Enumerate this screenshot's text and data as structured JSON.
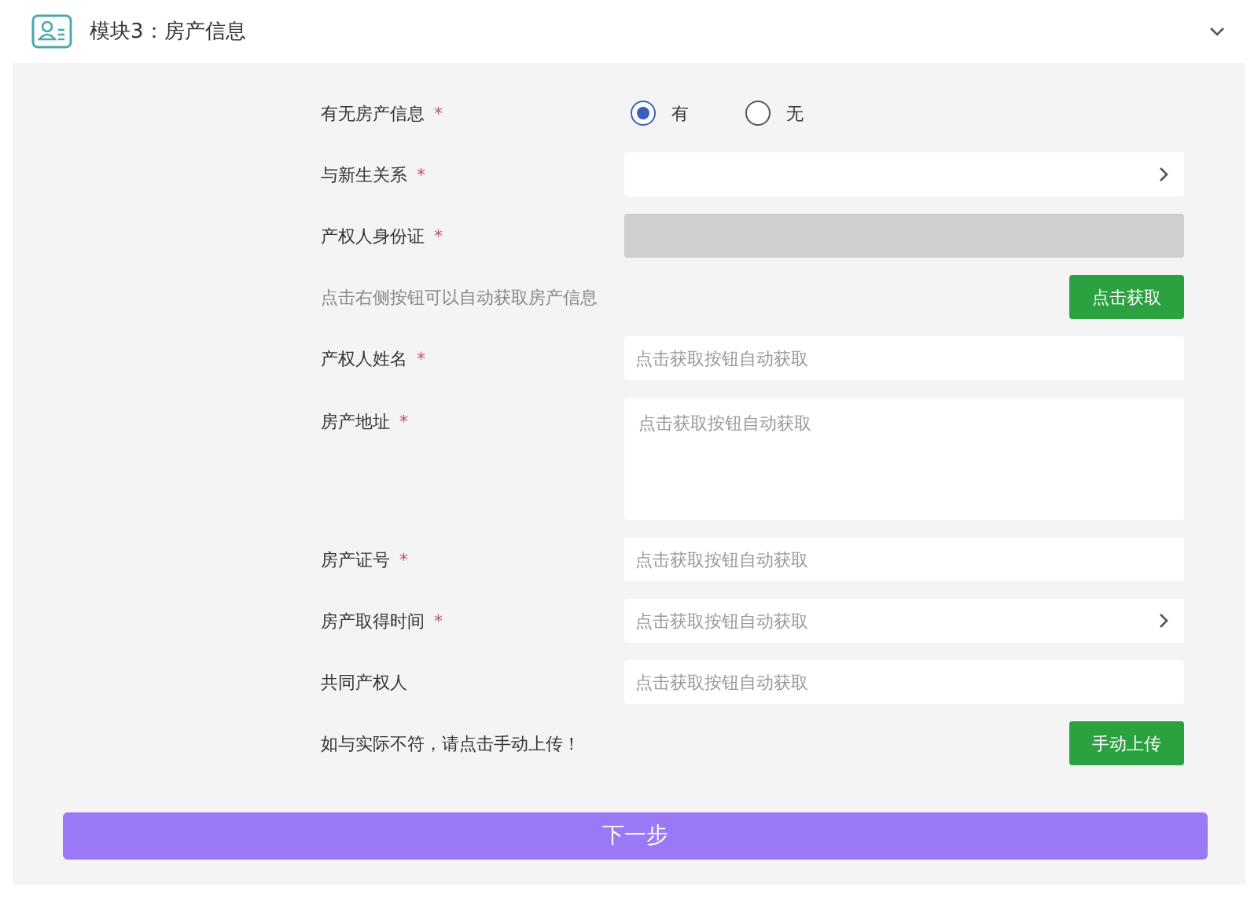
{
  "section": {
    "title": "模块3：房产信息",
    "expanded": true
  },
  "rows": [
    {
      "kind": "radio",
      "label": "有无房产信息",
      "mark": "*",
      "options": [
        {
          "label": "有",
          "selected": true
        },
        {
          "label": "无",
          "selected": false
        }
      ]
    },
    {
      "kind": "select",
      "label": "与新生关系",
      "mark": "*"
    },
    {
      "kind": "masked",
      "label": "产权人身份证",
      "mark": "*"
    },
    {
      "kind": "action",
      "label": "点击右侧按钮可以自动获取房产信息",
      "hint": true,
      "button": "点击获取"
    },
    {
      "kind": "input",
      "label": "产权人姓名",
      "mark": "*",
      "placeholder": "点击获取按钮自动获取"
    },
    {
      "kind": "textarea",
      "label": "房产地址",
      "mark": "*",
      "placeholder": "点击获取按钮自动获取"
    },
    {
      "kind": "input",
      "label": "房产证号",
      "mark": "*",
      "placeholder": "点击获取按钮自动获取"
    },
    {
      "kind": "select",
      "label": "房产取得时间",
      "mark": "*",
      "placeholder": "点击获取按钮自动获取"
    },
    {
      "kind": "input",
      "label": "共同产权人",
      "placeholder": "点击获取按钮自动获取"
    },
    {
      "kind": "action",
      "label": "如与实际不符，请点击手动上传！",
      "hint": false,
      "button": "手动上传"
    }
  ],
  "next_button": "下一步"
}
